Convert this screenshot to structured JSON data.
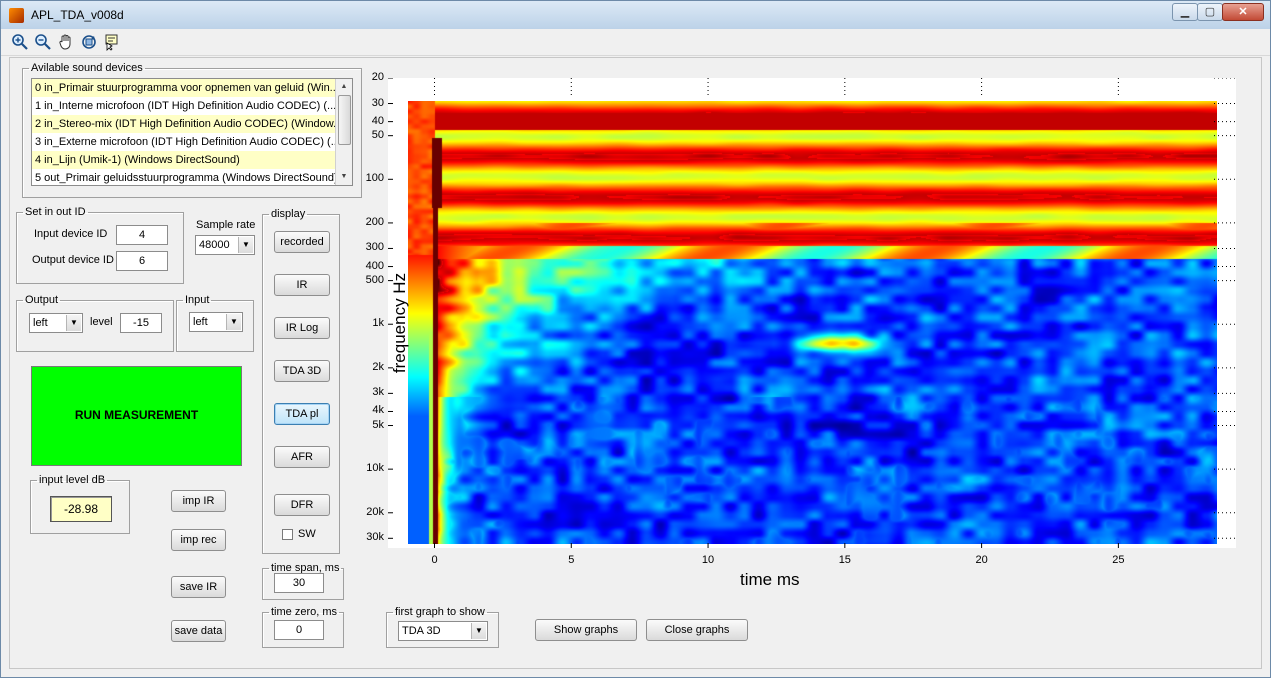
{
  "window": {
    "title": "APL_TDA_v008d"
  },
  "toolbar": [
    "zoom-in-icon",
    "zoom-out-icon",
    "pan-hand-icon",
    "rotate-3d-icon",
    "data-cursor-icon"
  ],
  "devices": {
    "legend": "Avilable sound devices",
    "items": [
      "0 in_Primair stuurprogramma voor opnemen van geluid (Win...",
      "1 in_Interne microfoon (IDT High Definition Audio CODEC) (...",
      "2 in_Stereo-mix (IDT High Definition Audio CODEC) (Window...",
      "3 in_Externe microfoon (IDT High Definition Audio CODEC) (...",
      "4 in_Lijn (Umik-1) (Windows DirectSound)",
      "5 out_Primair geluidsstuurprogramma (Windows DirectSound)"
    ]
  },
  "inout": {
    "legend": "Set in out ID",
    "input_label": "Input device ID",
    "input_value": "4",
    "output_label": "Output device ID",
    "output_value": "6"
  },
  "sample_rate": {
    "label": "Sample rate",
    "value": "48000"
  },
  "output": {
    "legend": "Output",
    "channel": "left",
    "level_label": "level",
    "level_value": "-15"
  },
  "input": {
    "legend": "Input",
    "channel": "left"
  },
  "run_label": "RUN MEASUREMENT",
  "input_level": {
    "legend": "input level dB",
    "value": "-28.98"
  },
  "imp_buttons": {
    "imp_ir": "imp IR",
    "imp_rec": "imp rec",
    "save_ir": "save IR",
    "save_data": "save data"
  },
  "display": {
    "legend": "display",
    "buttons": [
      "recorded",
      "IR",
      "IR Log",
      "TDA 3D",
      "TDA pl",
      "AFR",
      "DFR"
    ],
    "sw_label": "SW"
  },
  "time_span": {
    "legend": "time span, ms",
    "value": "30"
  },
  "time_zero": {
    "legend": "time zero, ms",
    "value": "0"
  },
  "first_graph": {
    "legend": "first graph to show",
    "value": "TDA 3D"
  },
  "show_graphs": "Show graphs",
  "close_graphs": "Close graphs",
  "chart_data": {
    "type": "heatmap",
    "xlabel": "time   ms",
    "ylabel": "frequency   Hz",
    "xlim": [
      -1.7,
      29.3
    ],
    "ylim": [
      20,
      35000
    ],
    "y_scale": "log",
    "x_ticks": [
      "0",
      "5",
      "10",
      "15",
      "20",
      "25"
    ],
    "x_tick_values": [
      0,
      5,
      10,
      15,
      20,
      25
    ],
    "y_ticks": [
      "20",
      "30",
      "40",
      "50",
      "100",
      "200",
      "300",
      "400",
      "500",
      "1k",
      "2k",
      "3k",
      "4k",
      "5k",
      "10k",
      "20k",
      "30k"
    ],
    "y_tick_values": [
      20,
      30,
      40,
      50,
      100,
      200,
      300,
      400,
      500,
      1000,
      2000,
      3000,
      4000,
      5000,
      10000,
      20000,
      30000
    ],
    "colormap": "jet",
    "data_x_range": [
      -1,
      29
    ],
    "data_y_range": [
      25,
      33000
    ]
  }
}
